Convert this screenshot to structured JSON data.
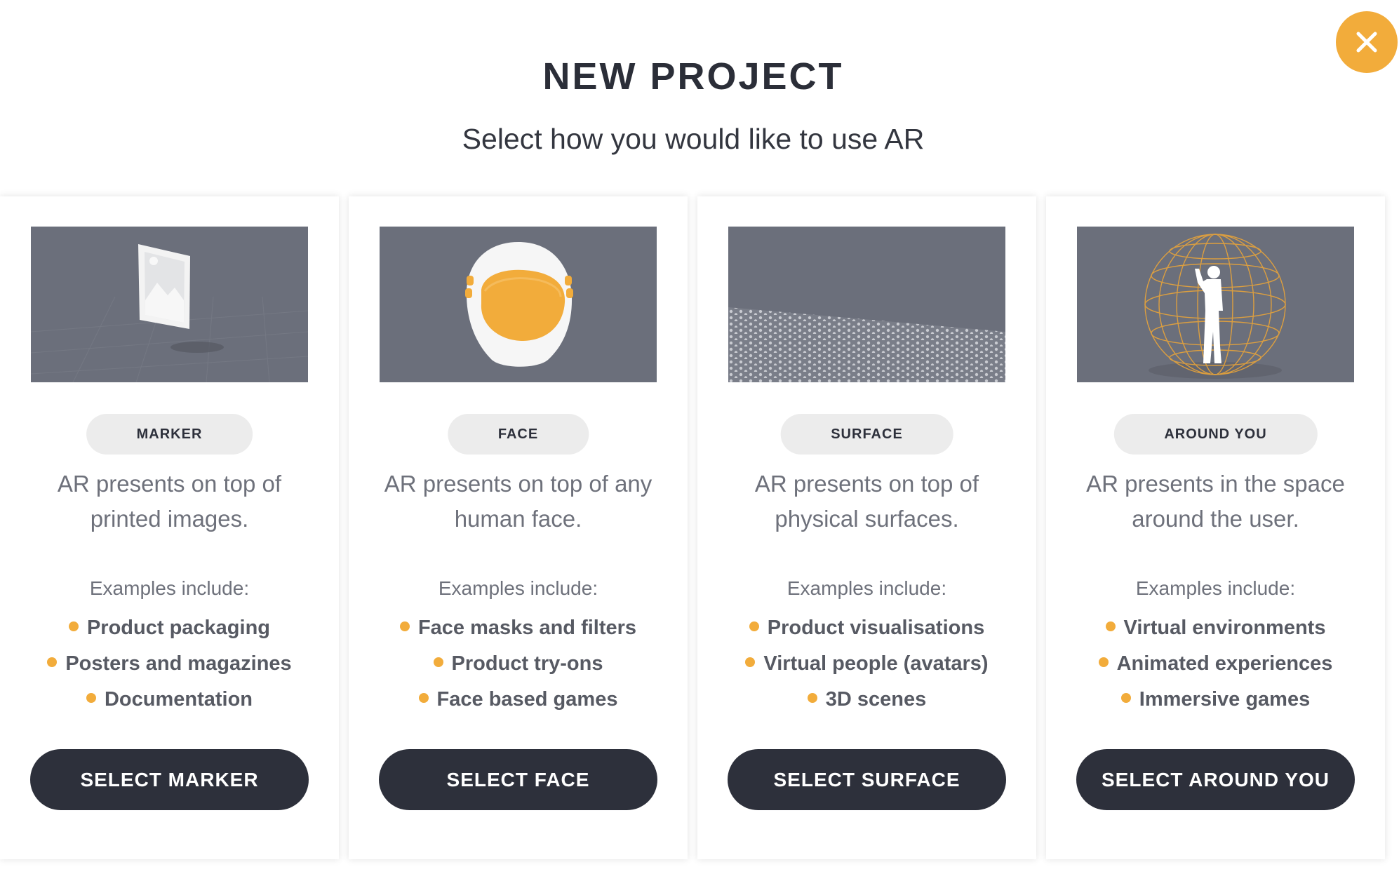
{
  "header": {
    "title": "NEW PROJECT",
    "subtitle": "Select how you would like to use AR"
  },
  "close_icon": "close-x-icon",
  "accent_color": "#f2ac3b",
  "dark_color": "#2d303b",
  "cards": [
    {
      "tag": "MARKER",
      "description": "AR presents on top of printed images.",
      "examples_label": "Examples include:",
      "examples": [
        "Product packaging",
        "Posters and magazines",
        "Documentation"
      ],
      "button": "SELECT MARKER",
      "image": "marker-image"
    },
    {
      "tag": "FACE",
      "description": "AR presents on top of any human face.",
      "examples_label": "Examples include:",
      "examples": [
        "Face masks and filters",
        "Product try-ons",
        "Face based games"
      ],
      "button": "SELECT FACE",
      "image": "face-helmet-image"
    },
    {
      "tag": "SURFACE",
      "description": "AR presents on top of physical surfaces.",
      "examples_label": "Examples include:",
      "examples": [
        "Product visualisations",
        "Virtual people (avatars)",
        "3D scenes"
      ],
      "button": "SELECT SURFACE",
      "image": "surface-dots-image"
    },
    {
      "tag": "AROUND YOU",
      "description": "AR presents in the space around the user.",
      "examples_label": "Examples include:",
      "examples": [
        "Virtual environments",
        "Animated experiences",
        "Immersive games"
      ],
      "button": "SELECT AROUND YOU",
      "image": "sphere-person-image"
    }
  ]
}
